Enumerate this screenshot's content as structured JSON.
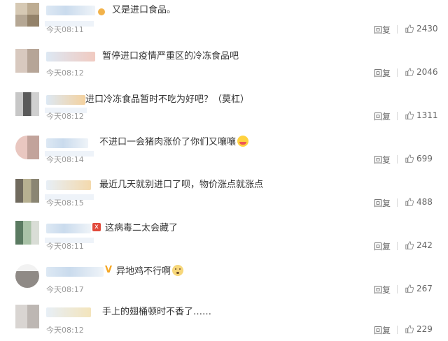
{
  "comments": [
    {
      "text": "又是进口食品。",
      "time": "今天08:11",
      "reply": "回复",
      "likes": "2430"
    },
    {
      "text": "暂停进口疫情严重区的冷冻食品吧",
      "time": "今天08:12",
      "reply": "回复",
      "likes": "2046"
    },
    {
      "text": "进口冷冻食品暂时不吃为好吧？（莫杠）",
      "time": "今天08:12",
      "reply": "回复",
      "likes": "1311"
    },
    {
      "text": "不进口一会猪肉涨价了你们又嚷嚷",
      "time": "今天08:14",
      "reply": "回复",
      "likes": "699"
    },
    {
      "text": "最近几天就别进口了呗，物价涨点就涨点",
      "time": "今天08:15",
      "reply": "回复",
      "likes": "488"
    },
    {
      "text": "这病毒二太会藏了",
      "time": "今天08:11",
      "reply": "回复",
      "likes": "242"
    },
    {
      "text": "异地鸡不行啊",
      "time": "今天08:17",
      "reply": "回复",
      "likes": "267"
    },
    {
      "text": "手上的翅桶顿时不香了……",
      "time": "今天08:12",
      "reply": "回复",
      "likes": "229"
    }
  ],
  "colors": {
    "text": "#333333",
    "meta": "#999999",
    "action": "#666666"
  },
  "icons": {
    "like": "thumbs-up-icon"
  }
}
